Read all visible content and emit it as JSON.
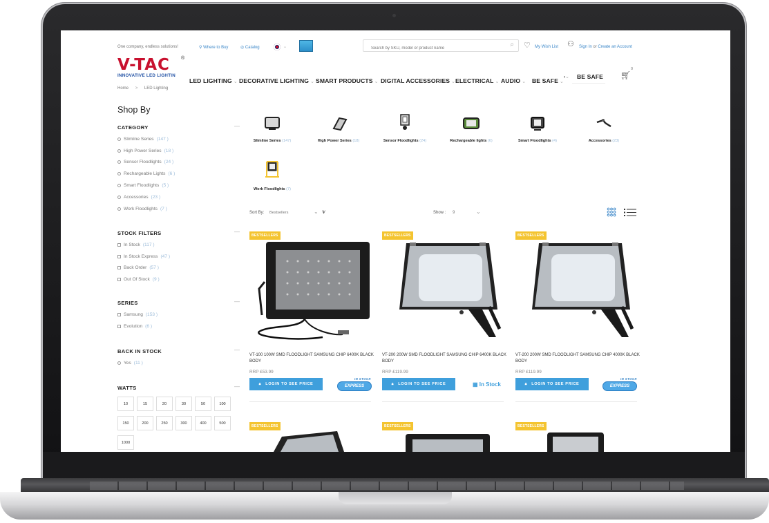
{
  "topbar": {
    "tagline": "One company, endless solutions!",
    "where_to_buy": "Where to Buy",
    "catalog": "Catalog",
    "search_placeholder": "Search by SKU, model or product name",
    "wishlist": "My Wish List",
    "sign_in": "Sign In",
    "or": "or",
    "create_account": "Create an Account",
    "cart_count": "0"
  },
  "logo": {
    "brand": "V-TAC",
    "tagline": "INNOVATIVE LED LIGHTIN",
    "registered": "®"
  },
  "breadcrumb": {
    "home": "Home",
    "sep": ">",
    "current": "LED Lighting"
  },
  "nav": {
    "items": [
      "LED LIGHTING",
      "DECORATIVE LIGHTING",
      "SMART PRODUCTS",
      "DIGITAL ACCESSORIES",
      "ELECTRICAL",
      "AUDIO",
      "BE SAFE"
    ],
    "overflow": "BE SAFE"
  },
  "sidebar": {
    "title": "Shop By",
    "category": {
      "heading": "CATEGORY",
      "items": [
        {
          "label": "Slimline Series",
          "count": "(147 )"
        },
        {
          "label": "High Power Series",
          "count": "(18 )"
        },
        {
          "label": "Sensor Floodlights",
          "count": "(24 )"
        },
        {
          "label": "Rechargeable Lights",
          "count": "(6 )"
        },
        {
          "label": "Smart Floodlights",
          "count": "(5 )"
        },
        {
          "label": "Accessories",
          "count": "(23 )"
        },
        {
          "label": "Work Floodlights",
          "count": "(7 )"
        }
      ]
    },
    "stock": {
      "heading": "STOCK FILTERS",
      "items": [
        {
          "label": "In Stock",
          "count": "(117 )"
        },
        {
          "label": "In Stock Express",
          "count": "(47 )"
        },
        {
          "label": "Back Order",
          "count": "(57 )"
        },
        {
          "label": "Out Of Stock",
          "count": "(9 )"
        }
      ]
    },
    "series": {
      "heading": "SERIES",
      "items": [
        {
          "label": "Samsung",
          "count": "(153 )"
        },
        {
          "label": "Evolution",
          "count": "(6 )"
        }
      ]
    },
    "back_in_stock": {
      "heading": "BACK IN STOCK",
      "items": [
        {
          "label": "Yes",
          "count": "(11 )"
        }
      ]
    },
    "watts": {
      "heading": "WATTS",
      "values": [
        "10",
        "15",
        "20",
        "30",
        "50",
        "100",
        "150",
        "200",
        "250",
        "300",
        "400",
        "500",
        "1000"
      ]
    }
  },
  "categories": [
    {
      "label": "Slimline Series",
      "count": "(147)",
      "icon": "slimline-floodlight-icon"
    },
    {
      "label": "High Power Series",
      "count": "(18)",
      "icon": "high-power-floodlight-icon"
    },
    {
      "label": "Sensor Floodlights",
      "count": "(24)",
      "icon": "sensor-floodlight-icon"
    },
    {
      "label": "Rechargeable lights",
      "count": "(6)",
      "icon": "rechargeable-light-icon"
    },
    {
      "label": "Smart Floodlights",
      "count": "(4)",
      "icon": "smart-floodlight-icon"
    },
    {
      "label": "Accessories",
      "count": "(23)",
      "icon": "accessories-icon"
    },
    {
      "label": "Work Floodlights",
      "count": "(7)",
      "icon": "work-floodlight-icon"
    }
  ],
  "toolbar": {
    "sort_label": "Sort By:",
    "sort_value": "Bestsellers",
    "show_label": "Show :",
    "show_value": "9"
  },
  "products": [
    {
      "badge": "BESTSELLERS",
      "name": "VT-100 100W SMD FLOODLIGHT SAMSUNG CHIP 6400K BLACK BODY",
      "price": "RRP £53.99",
      "button": "LOGIN TO SEE PRICE",
      "stock": "express"
    },
    {
      "badge": "BESTSELLERS",
      "name": "VT-200 200W SMD FLOODLIGHT SAMSUNG CHIP 6400K BLACK BODY",
      "price": "RRP £119.99",
      "button": "LOGIN TO SEE PRICE",
      "stock": "instock"
    },
    {
      "badge": "BESTSELLERS",
      "name": "VT-200 200W SMD FLOODLIGHT SAMSUNG CHIP 4000K BLACK BODY",
      "price": "RRP £119.99",
      "button": "LOGIN TO SEE PRICE",
      "stock": "express"
    }
  ],
  "stock_labels": {
    "in_stock": "In Stock",
    "express_top": "IN STOCK",
    "express_main": "EXPRESS"
  },
  "next_row_badges": [
    "BESTSELLERS",
    "BESTSELLERS",
    "BESTSELLERS"
  ]
}
